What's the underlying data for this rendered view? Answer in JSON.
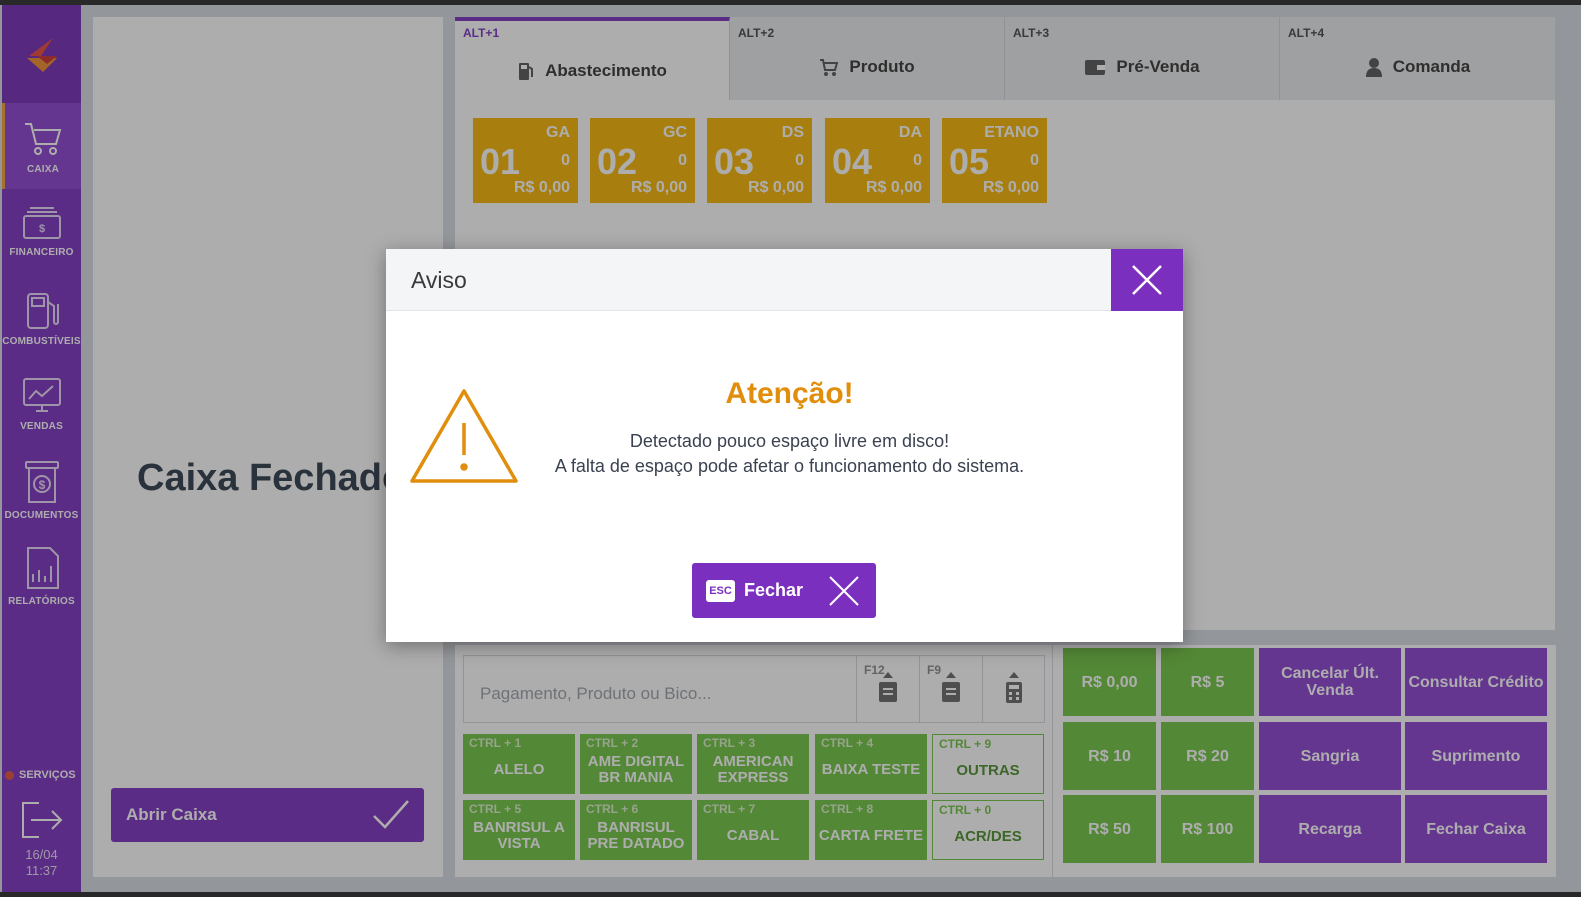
{
  "sidebar": {
    "items": [
      {
        "label": "CAIXA"
      },
      {
        "label": "FINANCEIRO"
      },
      {
        "label": "COMBUSTÍVEIS"
      },
      {
        "label": "VENDAS"
      },
      {
        "label": "DOCUMENTOS"
      },
      {
        "label": "RELATÓRIOS"
      }
    ],
    "services_label": "SERVIÇOS",
    "date": "16/04",
    "time": "11:37"
  },
  "left_panel": {
    "status_title": "Caixa Fechado",
    "open_button_label": "Abrir Caixa"
  },
  "tabs": [
    {
      "shortcut": "ALT+1",
      "label": "Abastecimento"
    },
    {
      "shortcut": "ALT+2",
      "label": "Produto"
    },
    {
      "shortcut": "ALT+3",
      "label": "Pré-Venda"
    },
    {
      "shortcut": "ALT+4",
      "label": "Comanda"
    }
  ],
  "pumps": [
    {
      "number": "01",
      "fuel": "GA",
      "qty": "0",
      "value": "R$ 0,00"
    },
    {
      "number": "02",
      "fuel": "GC",
      "qty": "0",
      "value": "R$ 0,00"
    },
    {
      "number": "03",
      "fuel": "DS",
      "qty": "0",
      "value": "R$ 0,00"
    },
    {
      "number": "04",
      "fuel": "DA",
      "qty": "0",
      "value": "R$ 0,00"
    },
    {
      "number": "05",
      "fuel": "ETANO",
      "qty": "0",
      "value": "R$ 0,00"
    }
  ],
  "search": {
    "placeholder": "Pagamento, Produto ou Bico...",
    "keys": [
      "F12",
      "F9",
      ""
    ]
  },
  "payments": [
    {
      "shortcut": "CTRL + 1",
      "label": "ALELO"
    },
    {
      "shortcut": "CTRL + 2",
      "label": "AME DIGITAL BR MANIA"
    },
    {
      "shortcut": "CTRL + 3",
      "label": "AMERICAN EXPRESS"
    },
    {
      "shortcut": "CTRL + 4",
      "label": "BAIXA TESTE"
    },
    {
      "shortcut": "CTRL + 9",
      "label": "OUTRAS"
    },
    {
      "shortcut": "CTRL + 5",
      "label": "BANRISUL A VISTA"
    },
    {
      "shortcut": "CTRL + 6",
      "label": "BANRISUL PRE DATADO"
    },
    {
      "shortcut": "CTRL + 7",
      "label": "CABAL"
    },
    {
      "shortcut": "CTRL + 8",
      "label": "CARTA FRETE"
    },
    {
      "shortcut": "CTRL + 0",
      "label": "ACR/DES"
    }
  ],
  "quick_values": [
    "R$ 0,00",
    "R$ 5",
    "R$ 10",
    "R$ 20",
    "R$ 50",
    "R$ 100"
  ],
  "actions": [
    "Cancelar Últ. Venda",
    "Consultar Crédito",
    "Sangria",
    "Suprimento",
    "Recarga",
    "Fechar Caixa"
  ],
  "modal": {
    "title": "Aviso",
    "heading": "Atenção!",
    "line1": "Detectado pouco espaço livre em disco!",
    "line2": "A falta de espaço pode afetar o funcionamento do sistema.",
    "esc_key": "ESC",
    "close_label": "Fechar"
  },
  "colors": {
    "brand_purple": "#7b2fbf",
    "pump_yellow": "#f7b500",
    "payment_green": "#6ec33f",
    "warning_orange": "#e08e0b"
  }
}
